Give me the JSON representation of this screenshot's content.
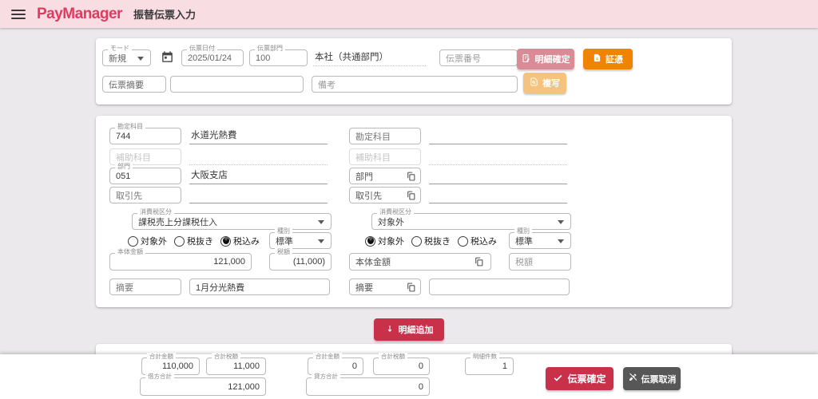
{
  "colors": {
    "header_bg": "#f8dde3",
    "brand": "#e13a60",
    "page_bg": "#ebe9eb",
    "accent_crimson": "#c9314b",
    "orange": "#f08300",
    "orange_light": "#f6c37f",
    "pink_muted": "#d98b96",
    "dark_button": "#575757"
  },
  "icons": {
    "menu-icon": "hamburger",
    "calendar-icon": "calendar",
    "copy-icon": "content-copy",
    "confirm-details-icon": "document-edit",
    "voucher-icon": "document",
    "copy-slip-icon": "document-search",
    "add-row-icon": "arrow-down",
    "confirm-slip-icon": "check",
    "cancel-slip-icon": "edit-off",
    "dropdown-icon": "caret-down"
  },
  "header": {
    "logo": "PayManager",
    "title": "振替伝票入力"
  },
  "top_form": {
    "mode": {
      "label": "モード",
      "value": "新規"
    },
    "slip_date": {
      "label": "伝票日付",
      "value": "2025/01/24"
    },
    "slip_dept": {
      "label": "伝票部門",
      "value": "100"
    },
    "slip_dept_name": "本社（共通部門）",
    "slip_number_placeholder": "伝票番号",
    "slip_summary_placeholder": "伝票摘要",
    "remarks_placeholder": "備考",
    "confirm_details_button": "明細確定",
    "voucher_button": "証憑",
    "copy_button": "複写"
  },
  "detail": {
    "debit": {
      "account_label": "勘定科目",
      "account_code": "744",
      "account_name": "水道光熱費",
      "sub_account_placeholder": "補助科目",
      "dept_label": "部門",
      "dept_code": "051",
      "dept_name": "大阪支店",
      "partner_placeholder": "取引先",
      "tax_class_label": "消費税区分",
      "tax_class_value": "課税売上分課税仕入",
      "tax_options": [
        "対象外",
        "税抜き",
        "税込み"
      ],
      "tax_selected": "税込み",
      "type_label": "種別",
      "type_value": "標準",
      "amount_label": "本体金額",
      "amount_value": "121,000",
      "tax_label": "税額",
      "tax_value": "(11,000)",
      "summary_placeholder": "摘要",
      "summary_value": "1月分光熱費"
    },
    "credit": {
      "account_placeholder": "勘定科目",
      "sub_account_placeholder": "補助科目",
      "dept_placeholder": "部門",
      "partner_placeholder": "取引先",
      "tax_class_label": "消費税区分",
      "tax_class_value": "対象外",
      "tax_options": [
        "対象外",
        "税抜き",
        "税込み"
      ],
      "tax_selected": "対象外",
      "type_label": "種別",
      "type_value": "標準",
      "amount_placeholder": "本体金額",
      "tax_placeholder": "税額",
      "summary_placeholder": "摘要"
    },
    "add_button": "明細追加"
  },
  "footer": {
    "debit": {
      "amount_label": "合計金額",
      "amount_value": "110,000",
      "tax_label": "合計税額",
      "tax_value": "11,000",
      "total_label": "借方合計",
      "total_value": "121,000"
    },
    "credit": {
      "amount_label": "合計金額",
      "amount_value": "0",
      "tax_label": "合計税額",
      "tax_value": "0",
      "total_label": "貸方合計",
      "total_value": "0"
    },
    "count_label": "明細件数",
    "count_value": "1",
    "confirm_button": "伝票確定",
    "cancel_button": "伝票取消"
  }
}
